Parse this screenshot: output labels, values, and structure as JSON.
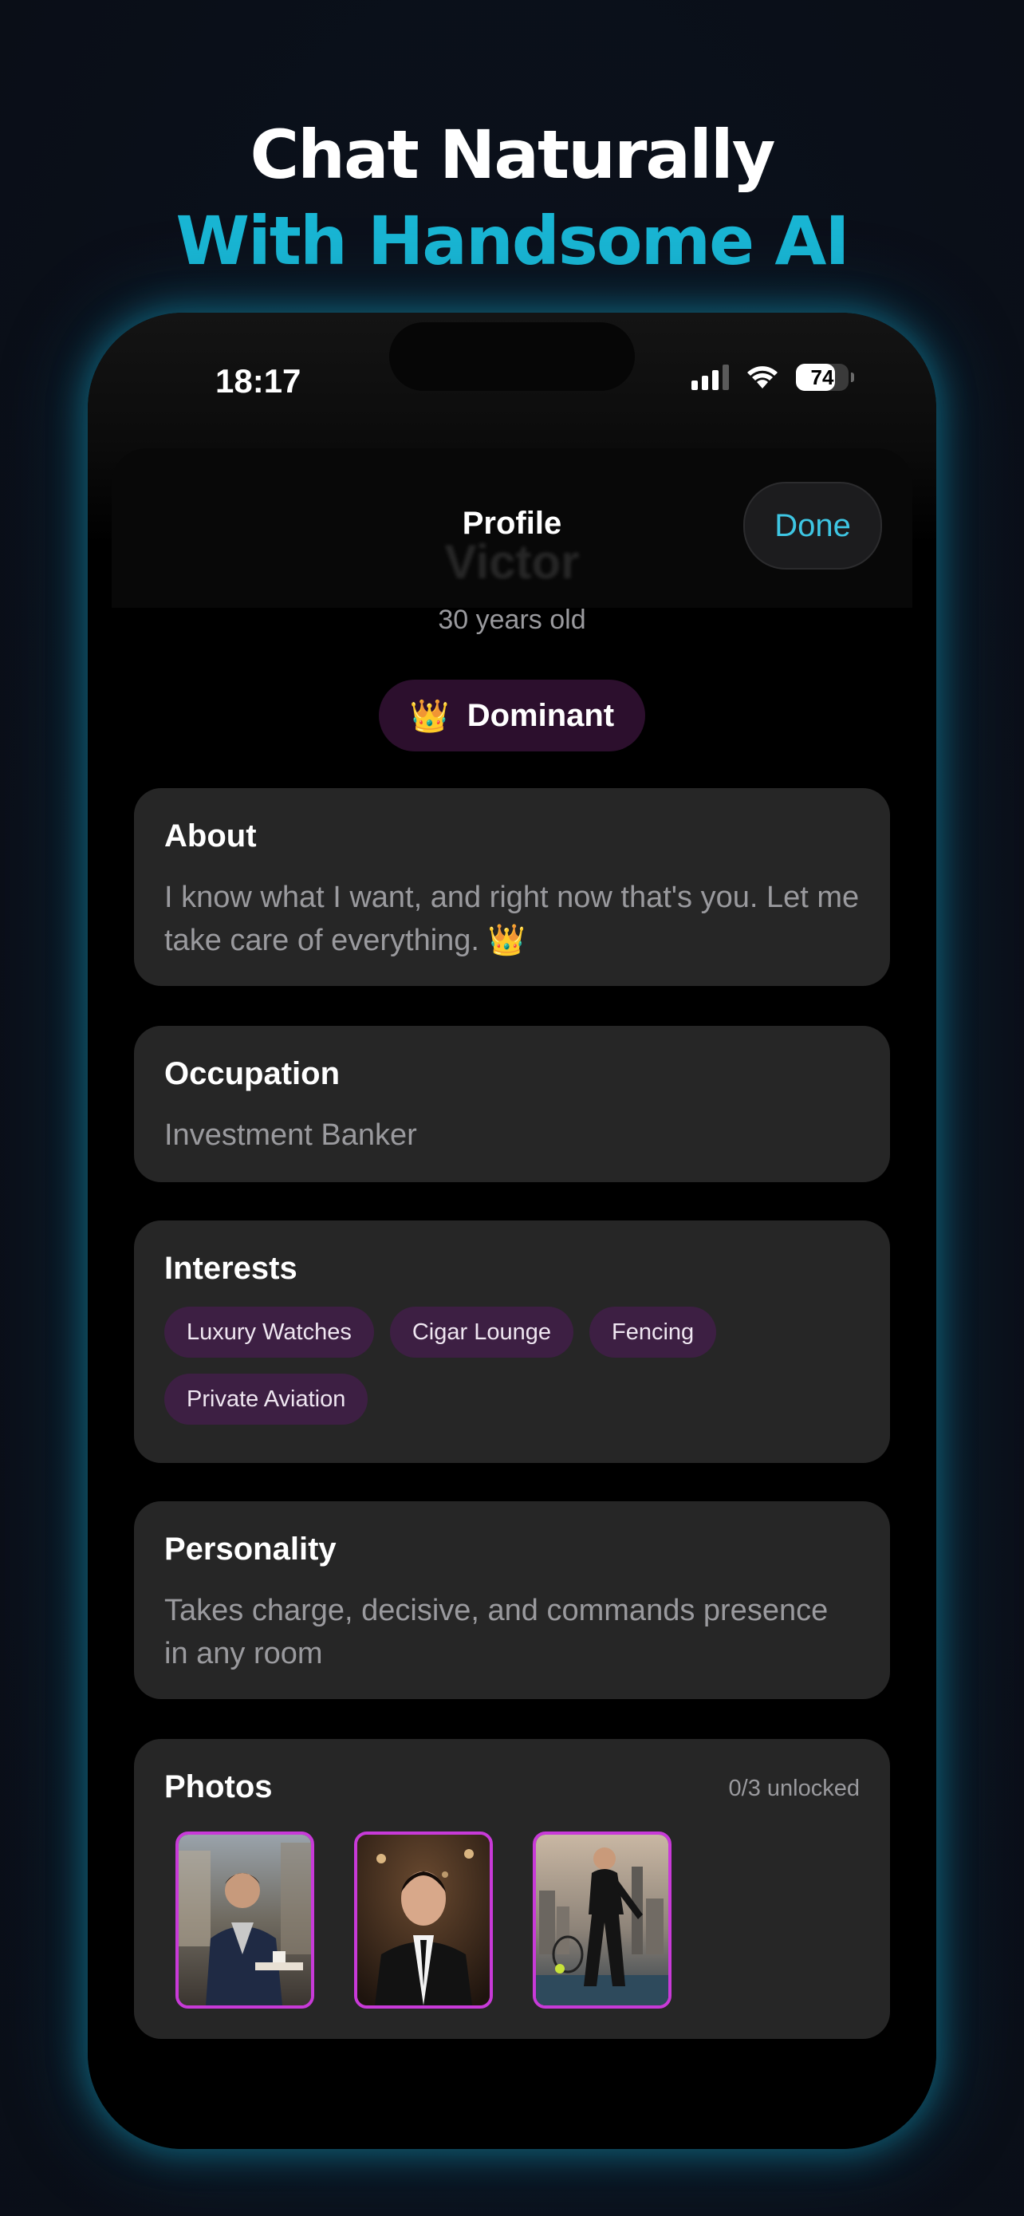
{
  "headline": {
    "line1": "Chat Naturally",
    "line2": "With Handsome AI"
  },
  "status_bar": {
    "time": "18:17",
    "battery": "74",
    "battery_level": 0.74
  },
  "nav": {
    "title": "Profile",
    "done_label": "Done"
  },
  "profile": {
    "name": "Victor",
    "age": "30 years old",
    "trait_icon": "👑",
    "trait": "Dominant"
  },
  "about": {
    "title": "About",
    "text": "I know what I want, and right now that's you. Let me take care of everything. 👑"
  },
  "occupation": {
    "title": "Occupation",
    "value": "Investment Banker"
  },
  "interests": {
    "title": "Interests",
    "items": [
      "Luxury Watches",
      "Cigar Lounge",
      "Fencing",
      "Private Aviation"
    ]
  },
  "personality": {
    "title": "Personality",
    "text": "Takes charge, decisive, and commands presence in any room"
  },
  "photos": {
    "title": "Photos",
    "unlocked": "0/3 unlocked",
    "items": [
      {
        "icon": "photo-cafe"
      },
      {
        "icon": "photo-portrait"
      },
      {
        "icon": "photo-tennis"
      }
    ]
  },
  "colors": {
    "accent": "#19b6d4",
    "done": "#3ec6e3",
    "chip_bg": "#3d1f43",
    "badge_bg": "#2c0f2d",
    "photo_border": "#c83ad8",
    "card_bg": "#262626"
  }
}
